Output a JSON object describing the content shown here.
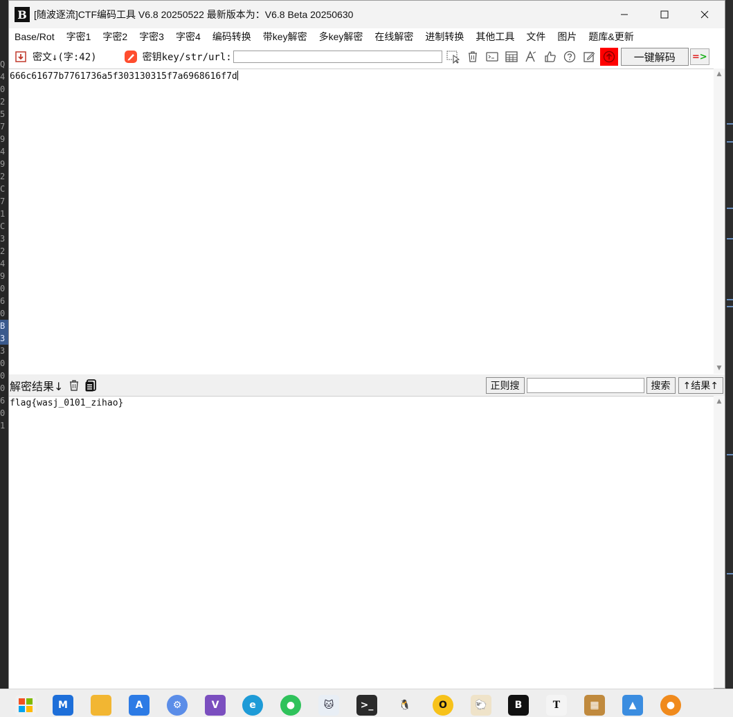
{
  "background_editor": {
    "line_prefixes": [
      "Q",
      "4",
      "0",
      "2",
      "5",
      "7",
      "9",
      "4",
      "9",
      "2",
      "C",
      "7",
      "1",
      "C",
      "3",
      "2",
      "4",
      "9",
      "0",
      "6",
      "0",
      "B",
      "3",
      "3",
      "0",
      "0",
      "0",
      "6",
      "0",
      "1"
    ]
  },
  "window": {
    "title": "[随波逐流]CTF编码工具 V6.8 20250522     最新版本为：V6.8 Beta 20250630",
    "logo_text": "B"
  },
  "menu": {
    "items": [
      "Base/Rot",
      "字密1",
      "字密2",
      "字密3",
      "字密4",
      "编码转换",
      "带key解密",
      "多key解密",
      "在线解密",
      "进制转换",
      "其他工具",
      "文件",
      "图片",
      "题库&更新"
    ]
  },
  "toolbar": {
    "cipher_label": "密文↓(字:42)",
    "key_label": "密钥key/str/url:",
    "key_value": "",
    "decode_button": "一键解码",
    "arrow_label": "=>"
  },
  "input": {
    "text": "666c61677b7761736a5f303130315f7a6968616f7d"
  },
  "result": {
    "label": "解密结果↓",
    "regex_button": "正则搜",
    "search_value": "",
    "search_button": "搜索",
    "result_nav_button": "↑结果↑",
    "text": "flag{wasj_0101_zihao}"
  },
  "colors": {
    "titlebar_bg": "#f3f3f3",
    "red_button": "#ff0000",
    "result_bar_bg": "#f0f0f0"
  },
  "taskbar": {
    "apps": [
      "windows-start",
      "mail",
      "file-explorer",
      "store",
      "settings",
      "visual-studio",
      "edge",
      "wechat",
      "cat-app",
      "terminal",
      "qq",
      "opera",
      "sheep-app",
      "ctf-tool",
      "typora",
      "package",
      "photos",
      "snail-app"
    ]
  }
}
